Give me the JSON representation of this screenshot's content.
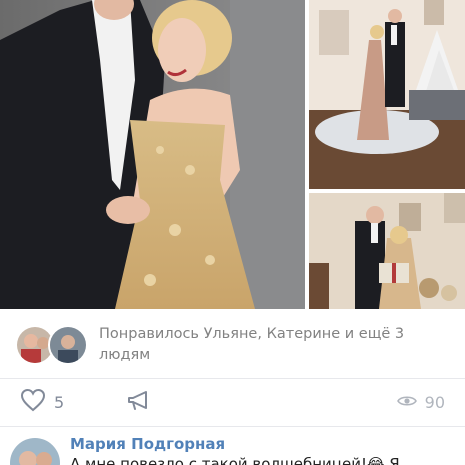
{
  "post": {
    "photos": [
      {
        "name": "couple-portrait-photo"
      },
      {
        "name": "couple-christmas-interior-photo"
      },
      {
        "name": "couple-gift-photo"
      }
    ],
    "likes_summary": "Понравилось Ульяне, Катерине и ещё 3 людям",
    "actions": {
      "like_icon": "heart-icon",
      "like_count": "5",
      "share_icon": "share-icon",
      "views_icon": "eye-icon",
      "views_count": "90"
    }
  },
  "comment": {
    "author": "Мария Подгорная",
    "text": "А мне повезло с такой волшебницей!😂 Я"
  },
  "colors": {
    "link": "#5181b8",
    "muted": "#828a99",
    "separator": "#e7e8ec"
  }
}
